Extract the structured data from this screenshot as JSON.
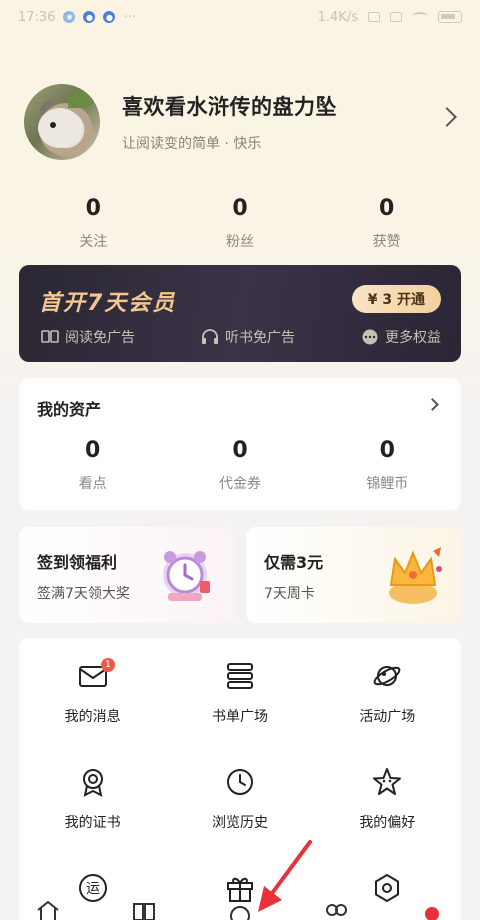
{
  "status_bar": {
    "time": "17:36",
    "network_speed": "1.4K/s",
    "battery": "73"
  },
  "profile": {
    "username": "喜欢看水浒传的盘力坠",
    "motto": "让阅读变的简单 · 快乐"
  },
  "stats": [
    {
      "value": "0",
      "label": "关注"
    },
    {
      "value": "0",
      "label": "粉丝"
    },
    {
      "value": "0",
      "label": "获赞"
    }
  ],
  "vip": {
    "title": "首开7天会员",
    "button": "¥ 3 开通",
    "perks": [
      {
        "icon": "book-icon",
        "label": "阅读免广告"
      },
      {
        "icon": "headphones-icon",
        "label": "听书免广告"
      },
      {
        "icon": "more-icon",
        "label": "更多权益"
      }
    ]
  },
  "assets": {
    "title": "我的资产",
    "items": [
      {
        "value": "0",
        "label": "看点"
      },
      {
        "value": "0",
        "label": "代金券"
      },
      {
        "value": "0",
        "label": "锦鲤币"
      }
    ]
  },
  "promos": [
    {
      "title": "签到领福利",
      "subtitle": "签满7天领大奖",
      "icon": "alarm-clock-icon"
    },
    {
      "title": "仅需3元",
      "subtitle": "7天周卡",
      "icon": "crown-icon"
    }
  ],
  "grid": [
    {
      "label": "我的消息",
      "icon": "mail-icon",
      "badge": "1"
    },
    {
      "label": "书单广场",
      "icon": "booklist-icon"
    },
    {
      "label": "活动广场",
      "icon": "planet-icon"
    },
    {
      "label": "我的证书",
      "icon": "medal-icon"
    },
    {
      "label": "浏览历史",
      "icon": "clock-icon"
    },
    {
      "label": "我的偏好",
      "icon": "star-icon"
    },
    {
      "label": "",
      "icon": "yun-icon"
    },
    {
      "label": "",
      "icon": "gift-icon"
    },
    {
      "label": "",
      "icon": "settings-icon"
    }
  ],
  "tabbar": [
    {
      "icon": "home-icon"
    },
    {
      "icon": "bookshelf-icon"
    },
    {
      "icon": "discover-icon"
    },
    {
      "icon": "community-icon"
    },
    {
      "icon": "profile-dot-icon"
    }
  ],
  "colors": {
    "accent_gold": "#f3c78e",
    "vip_bg": "#2e2a38",
    "badge_red": "#ef5a45"
  }
}
